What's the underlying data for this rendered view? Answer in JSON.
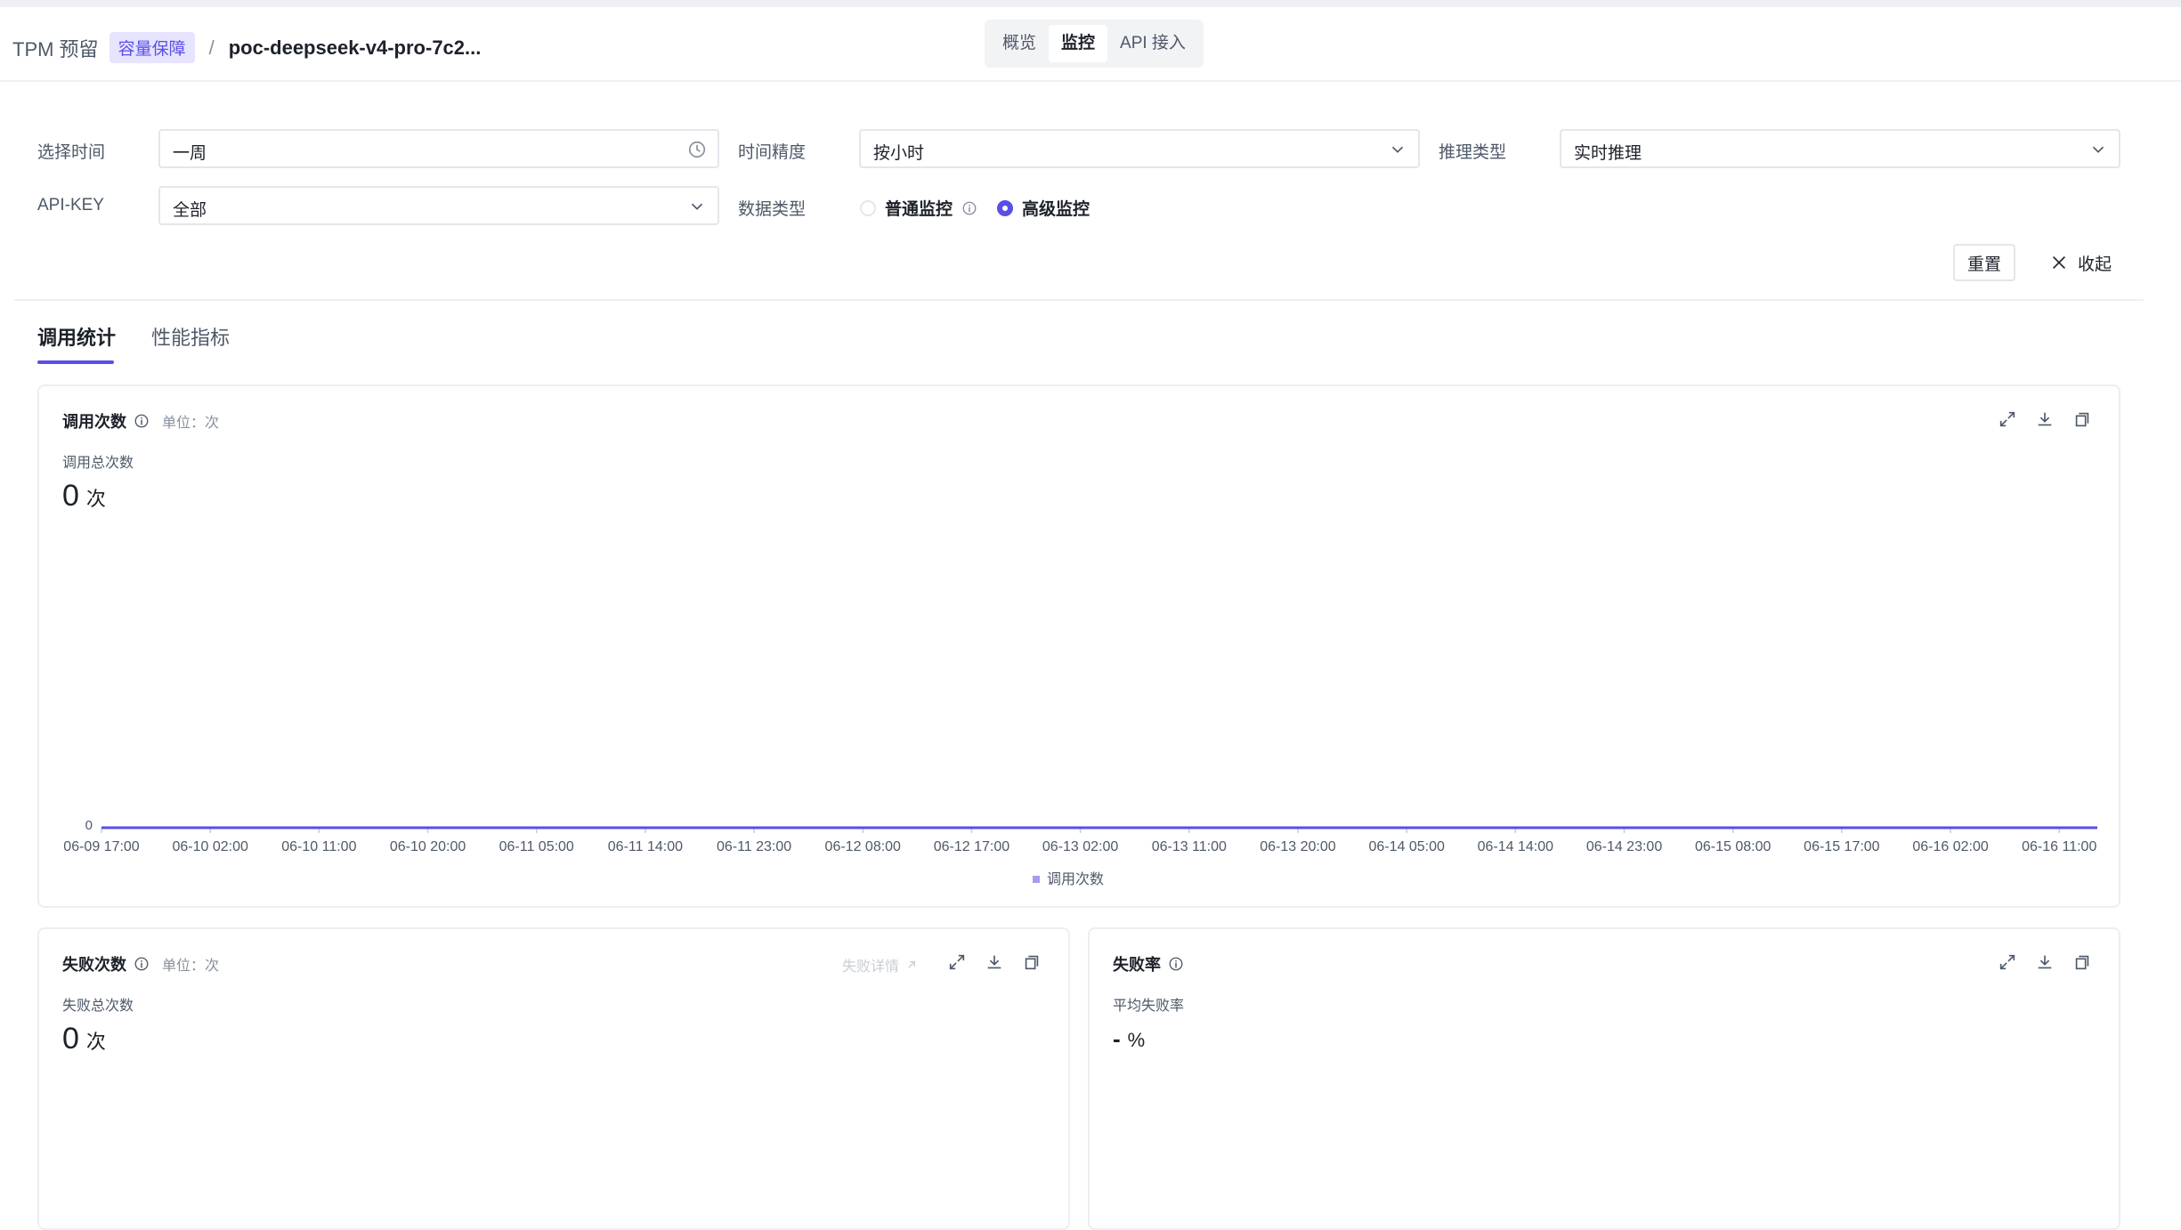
{
  "header": {
    "product": "TPM 预留",
    "badge": "容量保障",
    "separator": "/",
    "service_name": "poc-deepseek-v4-pro-7c2...",
    "tabs": [
      {
        "label": "概览",
        "active": false
      },
      {
        "label": "监控",
        "active": true
      },
      {
        "label": "API 接入",
        "active": false
      }
    ]
  },
  "filters": {
    "time_label": "选择时间",
    "time_value": "一周",
    "precision_label": "时间精度",
    "precision_value": "按小时",
    "inference_label": "推理类型",
    "inference_value": "实时推理",
    "apikey_label": "API-KEY",
    "apikey_value": "全部",
    "datatype_label": "数据类型",
    "datatype_options": [
      {
        "label": "普通监控",
        "selected": false
      },
      {
        "label": "高级监控",
        "selected": true
      }
    ],
    "reset_label": "重置",
    "collapse_label": "收起"
  },
  "tabs": [
    {
      "label": "调用统计",
      "active": true
    },
    {
      "label": "性能指标",
      "active": false
    }
  ],
  "calls_card": {
    "title": "调用次数",
    "unit": "单位：次",
    "total_label": "调用总次数",
    "total_value": "0",
    "total_unit": "次"
  },
  "failures_card": {
    "title": "失败次数",
    "unit": "单位：次",
    "detail_link": "失败详情",
    "total_label": "失败总次数",
    "total_value": "0",
    "total_unit": "次"
  },
  "failrate_card": {
    "title": "失败率",
    "avg_label": "平均失败率",
    "avg_value": "-",
    "avg_unit": "%"
  },
  "chart_data": {
    "type": "line",
    "x": [
      "06-09 17:00",
      "06-10 02:00",
      "06-10 11:00",
      "06-10 20:00",
      "06-11 05:00",
      "06-11 14:00",
      "06-11 23:00",
      "06-12 08:00",
      "06-12 17:00",
      "06-13 02:00",
      "06-13 11:00",
      "06-13 20:00",
      "06-14 05:00",
      "06-14 14:00",
      "06-14 23:00",
      "06-15 08:00",
      "06-15 17:00",
      "06-16 02:00",
      "06-16 11:00"
    ],
    "series": [
      {
        "name": "调用次数",
        "values": [
          0,
          0,
          0,
          0,
          0,
          0,
          0,
          0,
          0,
          0,
          0,
          0,
          0,
          0,
          0,
          0,
          0,
          0,
          0
        ]
      }
    ],
    "y_ticks": [
      "0"
    ],
    "ylim": [
      0,
      1
    ],
    "line_color": "#5b4ee8",
    "legend": "bottom-center",
    "grid": false
  },
  "colors": {
    "accent": "#5b4ee8",
    "badge_bg": "#e6e4ff"
  }
}
